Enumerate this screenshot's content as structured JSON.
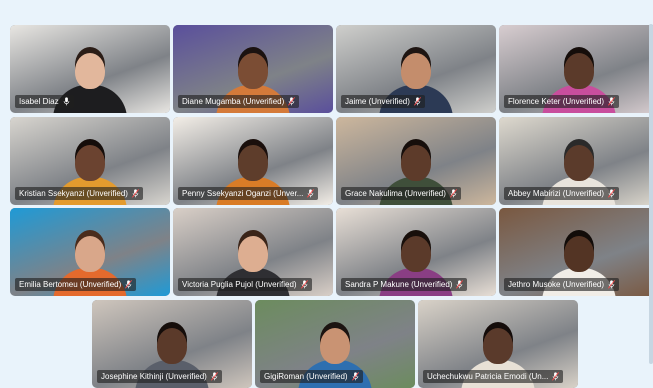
{
  "participants": [
    {
      "name": "Isabel Diaz",
      "muted": false,
      "bg": "#e8e6e2",
      "skin": "#e2b79c",
      "shirt": "#1d1d1f",
      "hair": "#2b1d17"
    },
    {
      "name": "Diane Mugamba (Unverified)",
      "muted": true,
      "bg": "#5a4f9c",
      "skin": "#7b4d34",
      "shirt": "#d47a3a",
      "hair": "#1b1210"
    },
    {
      "name": "Jaime (Unverified)",
      "muted": true,
      "bg": "#cfcfcc",
      "skin": "#c48d6c",
      "shirt": "#2c3a55",
      "hair": "#1e1512"
    },
    {
      "name": "Florence Keter (Unverified)",
      "muted": true,
      "bg": "#d8cdd0",
      "skin": "#5b3a2a",
      "shirt": "#c84e9d",
      "hair": "#150d0a"
    },
    {
      "name": "Kristian Ssekyanzi (Unverified)",
      "muted": true,
      "bg": "#d8d5cf",
      "skin": "#6b4330",
      "shirt": "#e39b2e",
      "hair": "#150d0a"
    },
    {
      "name": "Penny Ssekyanzi Oganzi (Unver...",
      "muted": true,
      "bg": "#f3eee7",
      "skin": "#5e3d2b",
      "shirt": "#d97c27",
      "hair": "#1a0f0c"
    },
    {
      "name": "Grace Nakulima (Unverified)",
      "muted": true,
      "bg": "#cdb79d",
      "skin": "#5d3b2a",
      "shirt": "#3f4f3a",
      "hair": "#160e0b"
    },
    {
      "name": "Abbey Mabirizi (Unverified)",
      "muted": true,
      "bg": "#ded9ce",
      "skin": "#5b3b2b",
      "shirt": "#e9e4dc",
      "hair": "#2a2a2a"
    },
    {
      "name": "Emilia Bertomeu (Unverified)",
      "muted": true,
      "bg": "#1f9ad6",
      "skin": "#d9a78a",
      "shirt": "#e46a2d",
      "hair": "#4a2c1c"
    },
    {
      "name": "Victoria Puglia Pujol (Unverified)",
      "muted": true,
      "bg": "#d9cfc7",
      "skin": "#ddae91",
      "shirt": "#2f2f33",
      "hair": "#3a2418"
    },
    {
      "name": "Sandra P Makune (Unverified)",
      "muted": true,
      "bg": "#e8dfd6",
      "skin": "#5b3a2a",
      "shirt": "#8a3e84",
      "hair": "#180f0b"
    },
    {
      "name": "Jethro Musoke (Unverified)",
      "muted": true,
      "bg": "#7a5840",
      "skin": "#533424",
      "shirt": "#f1ede7",
      "hair": "#120c09"
    },
    {
      "name": "Josephine Kithinji (Unverified)",
      "muted": true,
      "bg": "#cfc6bd",
      "skin": "#5b3a2a",
      "shirt": "#5a5f6a",
      "hair": "#150d0a"
    },
    {
      "name": "GigiRoman (Unverified)",
      "muted": true,
      "bg": "#6c8c5e",
      "skin": "#c99373",
      "shirt": "#2e6fb0",
      "hair": "#1c1411"
    },
    {
      "name": "Uchechukwu Patricia Emodi (Un...",
      "muted": true,
      "bg": "#d9d2c8",
      "skin": "#5a3a2b",
      "shirt": "#e8e1d6",
      "hair": "#140c0a"
    }
  ]
}
